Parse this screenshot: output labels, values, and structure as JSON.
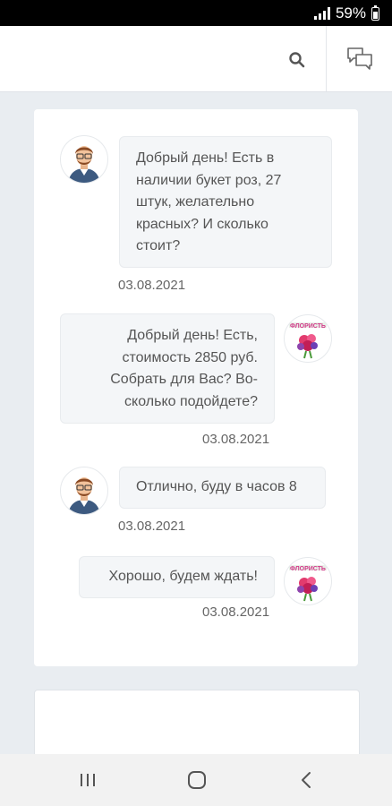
{
  "status_bar": {
    "battery": "59%"
  },
  "colors": {
    "text": "#555555",
    "bubble_bg": "#f4f6f8",
    "page_bg": "#e9edf1"
  },
  "header": {
    "icons": [
      "search-icon",
      "chat-icon"
    ]
  },
  "messages": [
    {
      "from": "user",
      "text": "Добрый день! Есть в наличии букет роз, 27 штук, желательно красных? И сколько стоит?",
      "date": "03.08.2021"
    },
    {
      "from": "shop",
      "text": "Добрый день! Есть, стоимость 2850 руб. Собрать для Вас? Во-сколько подойдете?",
      "date": "03.08.2021"
    },
    {
      "from": "user",
      "text": "Отлично, буду в часов 8",
      "date": "03.08.2021"
    },
    {
      "from": "shop",
      "text": "Хорошо, будем ждать!",
      "date": "03.08.2021"
    }
  ],
  "navbar": {
    "icons": [
      "recent-apps-icon",
      "home-icon",
      "back-icon"
    ]
  }
}
